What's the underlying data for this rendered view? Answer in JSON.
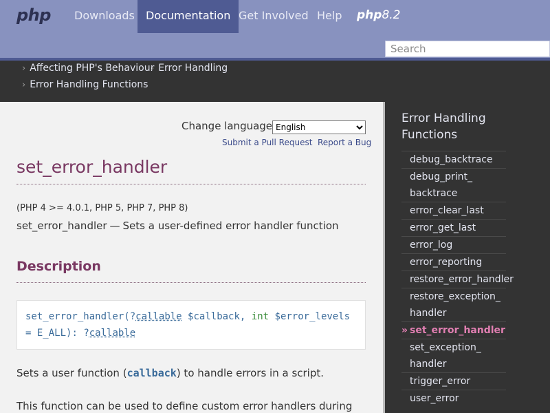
{
  "nav": {
    "logo": "php",
    "items": [
      "Downloads",
      "Documentation",
      "Get Involved",
      "Help"
    ],
    "active": "Documentation",
    "release_badge_prefix": "php",
    "release_badge_version": "8.2",
    "search_placeholder": "Search"
  },
  "breadcrumbs": [
    "Affecting PHP's Behaviour",
    "Error Handling",
    "Error Handling Functions"
  ],
  "crumb_chevron": "›",
  "main": {
    "change_language_label": "Change language:",
    "language_selected": "English",
    "submit_pull_request": "Submit a Pull Request",
    "report_bug": "Report a Bug",
    "function_title": "set_error_handler",
    "version_info": "(PHP 4 >= 4.0.1, PHP 5, PHP 7, PHP 8)",
    "refname": "set_error_handler",
    "dash": "—",
    "refpurpose": "Sets a user-defined error handler function",
    "description_heading": "Description",
    "signature": {
      "name": "set_error_handler",
      "open_paren": "(",
      "param1_prefix": "?",
      "param1_type": "callable",
      "param1_var": "$callback",
      "comma": ",",
      "param2_type": "int",
      "param2_var": "$error_levels",
      "param2_default": "= E_ALL",
      "close": "):",
      "return_prefix": "?",
      "return_type": "callable"
    },
    "para1_before": "Sets a user function (",
    "para1_code": "callback",
    "para1_after": ") to handle errors in a script.",
    "para2": "This function can be used to define custom error handlers during"
  },
  "sidebar": {
    "title": "Error Handling Functions",
    "current_marker": "»",
    "items": [
      {
        "label": "debug_backtrace",
        "current": false
      },
      {
        "label": "debug_print_\nbacktrace",
        "current": false
      },
      {
        "label": "error_clear_last",
        "current": false
      },
      {
        "label": "error_get_last",
        "current": false
      },
      {
        "label": "error_log",
        "current": false
      },
      {
        "label": "error_reporting",
        "current": false
      },
      {
        "label": "restore_error_handler",
        "current": false
      },
      {
        "label": "restore_exception_\nhandler",
        "current": false
      },
      {
        "label": "set_error_handler",
        "current": true
      },
      {
        "label": "set_exception_\nhandler",
        "current": false
      },
      {
        "label": "trigger_error",
        "current": false
      },
      {
        "label": "user_error",
        "current": false
      }
    ]
  },
  "colors": {
    "header": "#8892bf",
    "active_nav": "#4f5b93",
    "dark_band": "#333333",
    "title": "#793862",
    "current_item": "#e17fb2"
  }
}
